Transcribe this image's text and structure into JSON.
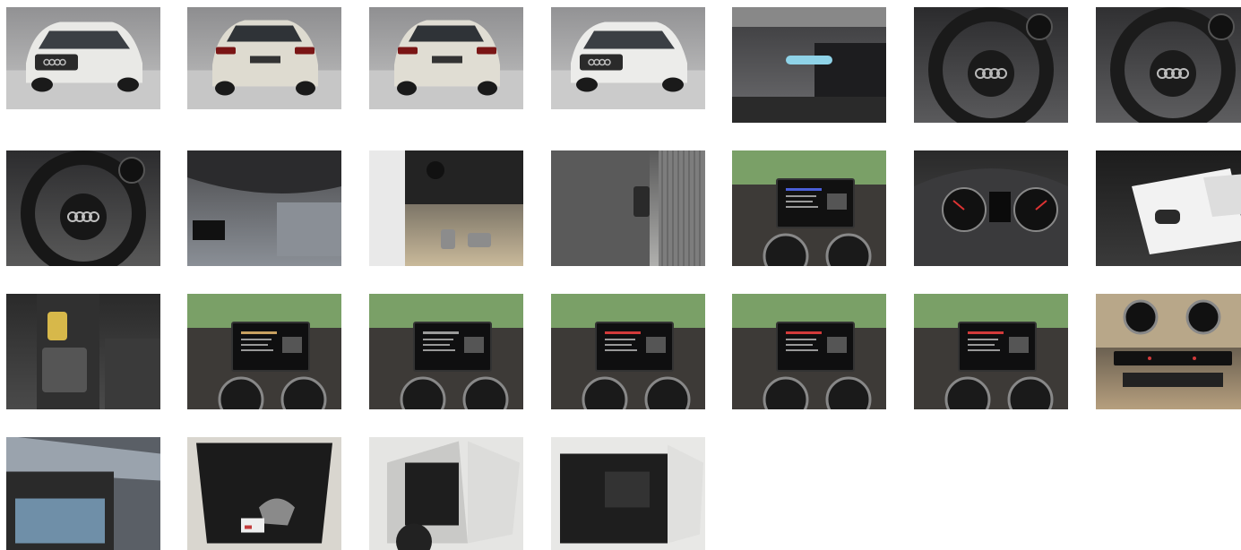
{
  "gallery": {
    "photos": [
      {
        "id": "p1",
        "subject": "car-front-studio",
        "colors": {
          "bg": "#8e8e90",
          "bg2": "#c9c9c9",
          "main": "#e9e9e6",
          "accent": "#2a2a2a"
        }
      },
      {
        "id": "p2",
        "subject": "car-rear-studio",
        "colors": {
          "bg": "#8a8a8c",
          "bg2": "#c6c6c6",
          "main": "#dedbd0",
          "accent": "#7a1515"
        }
      },
      {
        "id": "p3",
        "subject": "car-rear-studio",
        "colors": {
          "bg": "#8c8c8e",
          "bg2": "#c8c8c8",
          "main": "#e0ddd3",
          "accent": "#7a1515"
        }
      },
      {
        "id": "p4",
        "subject": "car-front-studio",
        "colors": {
          "bg": "#8f8f91",
          "bg2": "#cbcbcb",
          "main": "#ececea",
          "accent": "#2a2a2a"
        }
      },
      {
        "id": "p5",
        "subject": "dashboard-screen-closeup",
        "colors": {
          "bg": "#3a3a3c",
          "bg2": "#6d6d70",
          "main": "#1d1d1f",
          "accent": "#8fd3e8"
        }
      },
      {
        "id": "p6",
        "subject": "steering-wheel",
        "colors": {
          "bg": "#2b2b2d",
          "bg2": "#5a5a5c",
          "main": "#1a1a1a",
          "accent": "#b8b8b8"
        }
      },
      {
        "id": "p7",
        "subject": "steering-wheel",
        "colors": {
          "bg": "#303032",
          "bg2": "#5e5e60",
          "main": "#1b1b1b",
          "accent": "#bdbdbd"
        }
      },
      {
        "id": "p8",
        "subject": "steering-wheel",
        "colors": {
          "bg": "#2c2c2e",
          "bg2": "#595959",
          "main": "#171717",
          "accent": "#c0c0c0"
        }
      },
      {
        "id": "p9",
        "subject": "interior-headliner",
        "colors": {
          "bg": "#4a4a4c",
          "bg2": "#8a8f96",
          "main": "#2b2b2d",
          "accent": "#b9c3cc"
        }
      },
      {
        "id": "p10",
        "subject": "footwell-pedals",
        "colors": {
          "bg": "#3b3b3c",
          "bg2": "#c9b99a",
          "main": "#232323",
          "accent": "#8c8c8c"
        }
      },
      {
        "id": "p11",
        "subject": "door-panel",
        "colors": {
          "bg": "#5a5a5a",
          "bg2": "#b0b0ae",
          "main": "#2a2a2a",
          "accent": "#8a8a8a"
        }
      },
      {
        "id": "p12",
        "subject": "infotainment-screen",
        "colors": {
          "bg": "#3a3a3a",
          "bg2": "#7aa067",
          "main": "#111111",
          "accent": "#4a5fd8"
        }
      },
      {
        "id": "p13",
        "subject": "instrument-cluster",
        "colors": {
          "bg": "#2a2a2a",
          "bg2": "#4d4d4f",
          "main": "#111111",
          "accent": "#d33"
        }
      },
      {
        "id": "p14",
        "subject": "keys-and-papers",
        "colors": {
          "bg": "#1c1c1c",
          "bg2": "#3a3a3a",
          "main": "#f2f2f2",
          "accent": "#2a2a2a"
        }
      },
      {
        "id": "p15",
        "subject": "gear-shifter",
        "colors": {
          "bg": "#2a2a2a",
          "bg2": "#4a4a4a",
          "main": "#1a1a1a",
          "accent": "#d7b84a"
        }
      },
      {
        "id": "p16",
        "subject": "infotainment-screen",
        "colors": {
          "bg": "#3a3a3a",
          "bg2": "#7aa067",
          "main": "#0f0f10",
          "accent": "#c8a060"
        }
      },
      {
        "id": "p17",
        "subject": "infotainment-screen",
        "colors": {
          "bg": "#3a3a3a",
          "bg2": "#7aa067",
          "main": "#0f0f10",
          "accent": "#9a9a9a"
        }
      },
      {
        "id": "p18",
        "subject": "infotainment-screen",
        "colors": {
          "bg": "#3a3a3a",
          "bg2": "#7aa067",
          "main": "#0f0f10",
          "accent": "#d23a3a"
        }
      },
      {
        "id": "p19",
        "subject": "infotainment-screen",
        "colors": {
          "bg": "#3a3a3a",
          "bg2": "#7aa067",
          "main": "#0f0f10",
          "accent": "#d23a3a"
        }
      },
      {
        "id": "p20",
        "subject": "infotainment-screen",
        "colors": {
          "bg": "#3a3a3a",
          "bg2": "#7aa067",
          "main": "#0f0f10",
          "accent": "#d23a3a"
        }
      },
      {
        "id": "p21",
        "subject": "climate-controls",
        "colors": {
          "bg": "#2a2a2a",
          "bg2": "#b69f7e",
          "main": "#1a1a1a",
          "accent": "#d23a3a"
        }
      },
      {
        "id": "p22",
        "subject": "open-tailgate",
        "colors": {
          "bg": "#5a5f66",
          "bg2": "#9aa3ad",
          "main": "#2a2a2a",
          "accent": "#6f8fa8"
        }
      },
      {
        "id": "p23",
        "subject": "trunk-interior",
        "colors": {
          "bg": "#2a2a2a",
          "bg2": "#a89f90",
          "main": "#1b1b1b",
          "accent": "#c23a3a"
        }
      },
      {
        "id": "p24",
        "subject": "rear-door-open",
        "colors": {
          "bg": "#e5e5e3",
          "bg2": "#bfbfbd",
          "main": "#1e1e1e",
          "accent": "#8a8a8a"
        }
      },
      {
        "id": "p25",
        "subject": "front-door-open",
        "colors": {
          "bg": "#e8e8e6",
          "bg2": "#c4c4c2",
          "main": "#1e1e1e",
          "accent": "#8a8a8a"
        }
      }
    ]
  }
}
